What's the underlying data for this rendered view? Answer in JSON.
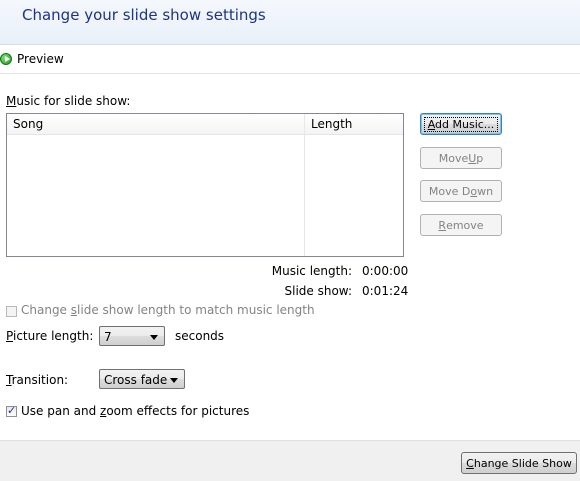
{
  "header": {
    "title": "Change your slide show settings"
  },
  "toolbar": {
    "preview_label": "Preview"
  },
  "music": {
    "section_label_accel": "M",
    "section_label_rest": "usic for slide show:",
    "columns": [
      "Song",
      "Length"
    ],
    "rows": []
  },
  "buttons": {
    "add_music": {
      "pre": "",
      "accel": "A",
      "post": "dd Music..."
    },
    "move_up": {
      "pre": "Move ",
      "accel": "U",
      "post": "p"
    },
    "move_down": {
      "pre": "Move D",
      "accel": "o",
      "post": "wn"
    },
    "remove": {
      "pre": "",
      "accel": "R",
      "post": "emove"
    },
    "change_slide_show": {
      "pre": "",
      "accel": "C",
      "post": "hange Slide Show"
    }
  },
  "summary": {
    "music_length_label": "Music length:",
    "music_length_value": "0:00:00",
    "slide_show_label": "Slide show:",
    "slide_show_value": "0:01:24"
  },
  "match_length": {
    "pre": "Change ",
    "accel": "s",
    "post": "lide show length to match music length",
    "checked": false,
    "enabled": false
  },
  "picture_length": {
    "accel": "P",
    "rest": "icture length:",
    "value": "7",
    "unit": "seconds"
  },
  "transition": {
    "accel": "T",
    "rest": "ransition:",
    "value": "Cross fade"
  },
  "pan_zoom": {
    "pre": "Use pan and ",
    "accel": "z",
    "post": "oom effects for pictures",
    "checked": true
  }
}
